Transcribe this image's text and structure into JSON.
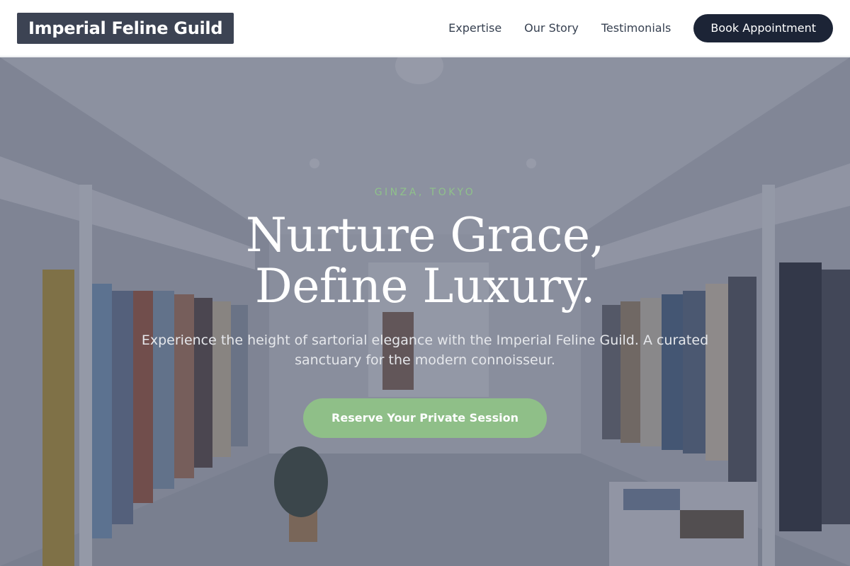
{
  "brand": {
    "name": "Imperial Feline Guild"
  },
  "nav": {
    "links": [
      {
        "label": "Expertise"
      },
      {
        "label": "Our Story"
      },
      {
        "label": "Testimonials"
      }
    ],
    "cta_label": "Book Appointment"
  },
  "hero": {
    "eyebrow": "GINZA, TOKYO",
    "headline_line1": "Nurture Grace,",
    "headline_line2": "Define Luxury.",
    "subtitle": "Experience the height of sartorial elegance with the Imperial Feline Guild. A curated sanctuary for the modern connoisseur.",
    "cta_label": "Reserve Your Private Session",
    "background": "boutique-interior-clothing-racks-photo"
  },
  "colors": {
    "brand_bg": "#3c4353",
    "nav_button": "#1c2436",
    "accent_green": "#8fbf88",
    "eyebrow_green": "#8fc18a"
  }
}
